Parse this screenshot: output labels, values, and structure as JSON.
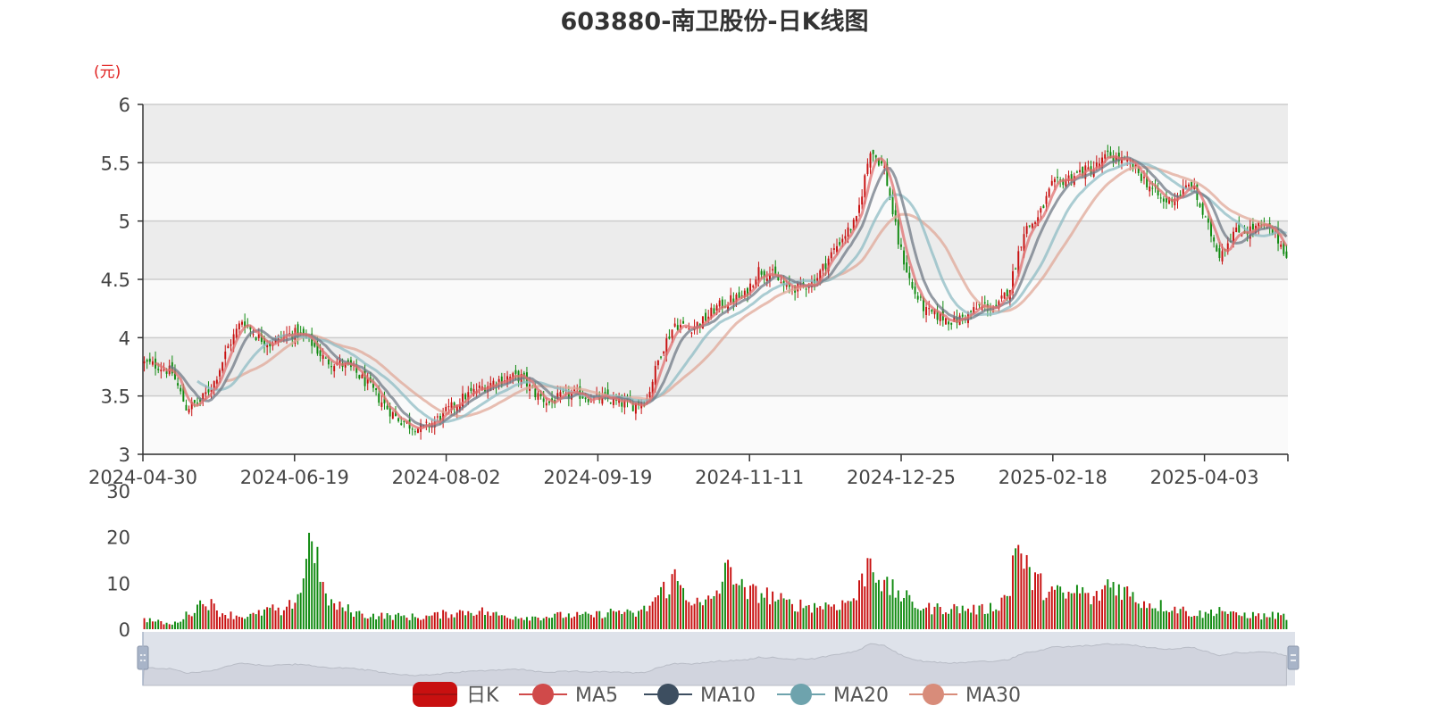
{
  "chart_data": {
    "type": "candlestick",
    "title": "603880-南卫股份-日K线图",
    "unit": "(元)",
    "x_tick_labels": [
      "2024-04-30",
      "2024-06-19",
      "2024-08-02",
      "2024-09-19",
      "2024-11-11",
      "2024-12-25",
      "2025-02-18",
      "2025-04-03"
    ],
    "price_ylim": [
      3,
      6
    ],
    "price_ticks": [
      3,
      3.5,
      4,
      4.5,
      5,
      5.5,
      6
    ],
    "volume_ylim": [
      0,
      30
    ],
    "volume_ticks": [
      0,
      10,
      20,
      30
    ],
    "legend": [
      "日K",
      "MA5",
      "MA10",
      "MA20",
      "MA30"
    ],
    "colors": {
      "up": "#c81010",
      "down": "#108a10",
      "ma5": "#e07070",
      "ma10": "#707a85",
      "ma20": "#8fbcc4",
      "ma30": "#e0a898",
      "grid": "#cccccc",
      "band_dark": "#ececec",
      "band_light": "#fafafa",
      "navigator": "#d8dde6"
    },
    "close_anchors": [
      [
        0,
        3.78
      ],
      [
        5,
        3.76
      ],
      [
        10,
        3.7
      ],
      [
        15,
        3.4
      ],
      [
        20,
        3.45
      ],
      [
        25,
        3.62
      ],
      [
        30,
        3.92
      ],
      [
        35,
        4.15
      ],
      [
        40,
        4.02
      ],
      [
        45,
        3.95
      ],
      [
        50,
        4.02
      ],
      [
        55,
        4.04
      ],
      [
        60,
        3.95
      ],
      [
        65,
        3.8
      ],
      [
        70,
        3.78
      ],
      [
        75,
        3.72
      ],
      [
        80,
        3.6
      ],
      [
        85,
        3.45
      ],
      [
        90,
        3.32
      ],
      [
        95,
        3.25
      ],
      [
        100,
        3.22
      ],
      [
        105,
        3.3
      ],
      [
        110,
        3.4
      ],
      [
        115,
        3.5
      ],
      [
        120,
        3.56
      ],
      [
        125,
        3.62
      ],
      [
        130,
        3.66
      ],
      [
        135,
        3.66
      ],
      [
        140,
        3.52
      ],
      [
        145,
        3.44
      ],
      [
        150,
        3.5
      ],
      [
        155,
        3.52
      ],
      [
        160,
        3.48
      ],
      [
        165,
        3.48
      ],
      [
        170,
        3.44
      ],
      [
        175,
        3.42
      ],
      [
        180,
        3.48
      ],
      [
        185,
        3.88
      ],
      [
        190,
        4.12
      ],
      [
        195,
        4.08
      ],
      [
        200,
        4.14
      ],
      [
        205,
        4.26
      ],
      [
        210,
        4.32
      ],
      [
        215,
        4.36
      ],
      [
        220,
        4.58
      ],
      [
        225,
        4.54
      ],
      [
        230,
        4.42
      ],
      [
        235,
        4.44
      ],
      [
        240,
        4.48
      ],
      [
        245,
        4.68
      ],
      [
        250,
        4.86
      ],
      [
        255,
        5.0
      ],
      [
        260,
        5.62
      ],
      [
        265,
        5.45
      ],
      [
        270,
        4.82
      ],
      [
        275,
        4.42
      ],
      [
        280,
        4.22
      ],
      [
        285,
        4.18
      ],
      [
        290,
        4.14
      ],
      [
        295,
        4.2
      ],
      [
        300,
        4.28
      ],
      [
        305,
        4.24
      ],
      [
        310,
        4.44
      ],
      [
        315,
        4.92
      ],
      [
        320,
        5.02
      ],
      [
        325,
        5.3
      ],
      [
        330,
        5.36
      ],
      [
        335,
        5.42
      ],
      [
        340,
        5.45
      ],
      [
        345,
        5.56
      ],
      [
        350,
        5.52
      ],
      [
        355,
        5.44
      ],
      [
        360,
        5.3
      ],
      [
        365,
        5.16
      ],
      [
        370,
        5.22
      ],
      [
        375,
        5.32
      ],
      [
        380,
        5.0
      ],
      [
        385,
        4.72
      ],
      [
        390,
        4.9
      ],
      [
        395,
        4.92
      ],
      [
        400,
        4.96
      ],
      [
        405,
        4.88
      ],
      [
        409,
        4.72
      ]
    ],
    "volume_anchors": [
      [
        0,
        2.2
      ],
      [
        10,
        1.0
      ],
      [
        14,
        2.5
      ],
      [
        18,
        4.5
      ],
      [
        22,
        6.5
      ],
      [
        26,
        4.0
      ],
      [
        30,
        3.2
      ],
      [
        35,
        2.8
      ],
      [
        40,
        3.0
      ],
      [
        45,
        4.5
      ],
      [
        50,
        3.2
      ],
      [
        56,
        8.5
      ],
      [
        60,
        22.0
      ],
      [
        64,
        8.0
      ],
      [
        68,
        5.0
      ],
      [
        72,
        4.5
      ],
      [
        76,
        3.5
      ],
      [
        80,
        3.0
      ],
      [
        90,
        2.8
      ],
      [
        100,
        2.6
      ],
      [
        110,
        3.5
      ],
      [
        115,
        3.8
      ],
      [
        120,
        4.0
      ],
      [
        125,
        3.2
      ],
      [
        130,
        2.8
      ],
      [
        140,
        2.6
      ],
      [
        150,
        3.0
      ],
      [
        160,
        2.9
      ],
      [
        170,
        4.0
      ],
      [
        175,
        3.0
      ],
      [
        180,
        4.5
      ],
      [
        185,
        8.0
      ],
      [
        190,
        11.0
      ],
      [
        195,
        7.0
      ],
      [
        200,
        4.8
      ],
      [
        205,
        8.0
      ],
      [
        210,
        14.0
      ],
      [
        215,
        7.5
      ],
      [
        220,
        8.0
      ],
      [
        225,
        7.0
      ],
      [
        230,
        5.5
      ],
      [
        240,
        5.0
      ],
      [
        250,
        5.5
      ],
      [
        255,
        7.0
      ],
      [
        260,
        16.0
      ],
      [
        265,
        9.0
      ],
      [
        270,
        8.0
      ],
      [
        275,
        5.5
      ],
      [
        280,
        4.5
      ],
      [
        290,
        4.5
      ],
      [
        300,
        4.2
      ],
      [
        305,
        5.0
      ],
      [
        310,
        8.0
      ],
      [
        312,
        22.0
      ],
      [
        314,
        15.0
      ],
      [
        318,
        11.0
      ],
      [
        322,
        9.0
      ],
      [
        326,
        8.0
      ],
      [
        330,
        7.0
      ],
      [
        335,
        8.5
      ],
      [
        340,
        6.0
      ],
      [
        345,
        10.0
      ],
      [
        350,
        9.0
      ],
      [
        355,
        6.5
      ],
      [
        360,
        5.5
      ],
      [
        365,
        5.0
      ],
      [
        370,
        4.5
      ],
      [
        375,
        3.5
      ],
      [
        380,
        3.2
      ],
      [
        385,
        4.5
      ],
      [
        390,
        3.0
      ],
      [
        395,
        3.2
      ],
      [
        400,
        2.8
      ],
      [
        405,
        3.0
      ],
      [
        409,
        2.8
      ]
    ]
  }
}
